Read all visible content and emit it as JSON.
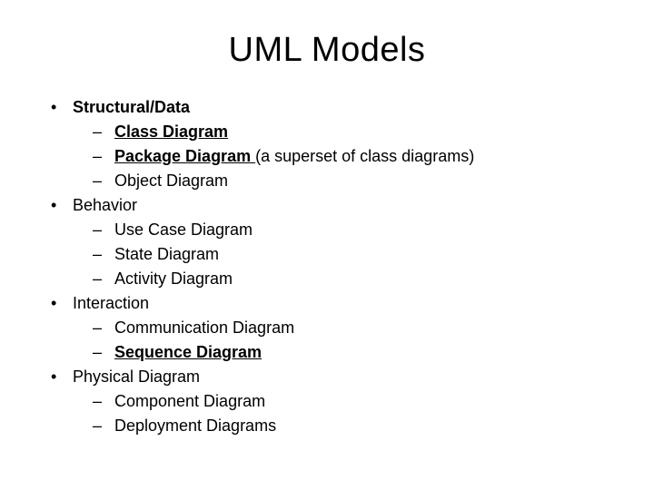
{
  "title": "UML Models",
  "sections": [
    {
      "label": "Structural/Data",
      "bold": true,
      "items": [
        {
          "label": "Class Diagram",
          "bold": true,
          "underline": true,
          "suffix": ""
        },
        {
          "label": "Package Diagram ",
          "bold": true,
          "underline": true,
          "suffix": "(a superset of class diagrams)"
        },
        {
          "label": "Object Diagram",
          "bold": false,
          "underline": false,
          "suffix": ""
        }
      ]
    },
    {
      "label": "Behavior",
      "bold": false,
      "items": [
        {
          "label": "Use Case Diagram",
          "bold": false,
          "underline": false,
          "suffix": ""
        },
        {
          "label": "State Diagram",
          "bold": false,
          "underline": false,
          "suffix": ""
        },
        {
          "label": "Activity Diagram",
          "bold": false,
          "underline": false,
          "suffix": ""
        }
      ]
    },
    {
      "label": "Interaction",
      "bold": false,
      "items": [
        {
          "label": "Communication Diagram",
          "bold": false,
          "underline": false,
          "suffix": ""
        },
        {
          "label": "Sequence Diagram",
          "bold": true,
          "underline": true,
          "suffix": ""
        }
      ]
    },
    {
      "label": "Physical Diagram",
      "bold": false,
      "items": [
        {
          "label": "Component Diagram",
          "bold": false,
          "underline": false,
          "suffix": ""
        },
        {
          "label": "Deployment Diagrams",
          "bold": false,
          "underline": false,
          "suffix": ""
        }
      ]
    }
  ]
}
